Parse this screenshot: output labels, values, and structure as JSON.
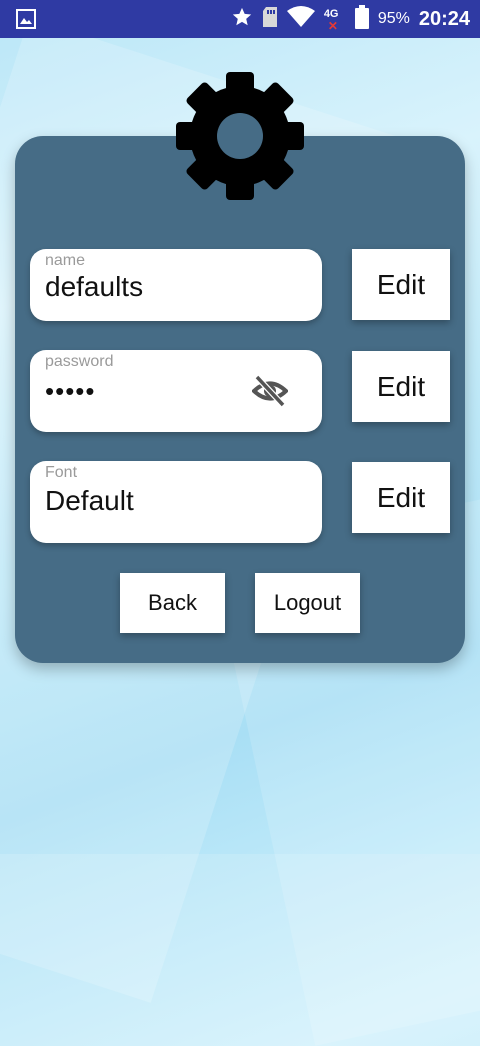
{
  "status_bar": {
    "network": "4G",
    "battery": "95%",
    "time": "20:24"
  },
  "header": {
    "icon": "gear-icon"
  },
  "settings": {
    "name": {
      "label": "name",
      "value": "defaults",
      "edit_label": "Edit"
    },
    "password": {
      "label": "password",
      "value": "•••••",
      "edit_label": "Edit",
      "visibility_icon": "eye-off-icon"
    },
    "font": {
      "label": "Font",
      "value": "Default",
      "edit_label": "Edit"
    }
  },
  "actions": {
    "back_label": "Back",
    "logout_label": "Logout"
  },
  "colors": {
    "status_bar": "#2f3aa3",
    "card": "#466c86",
    "field": "#ffffff",
    "gear": "#000000"
  }
}
